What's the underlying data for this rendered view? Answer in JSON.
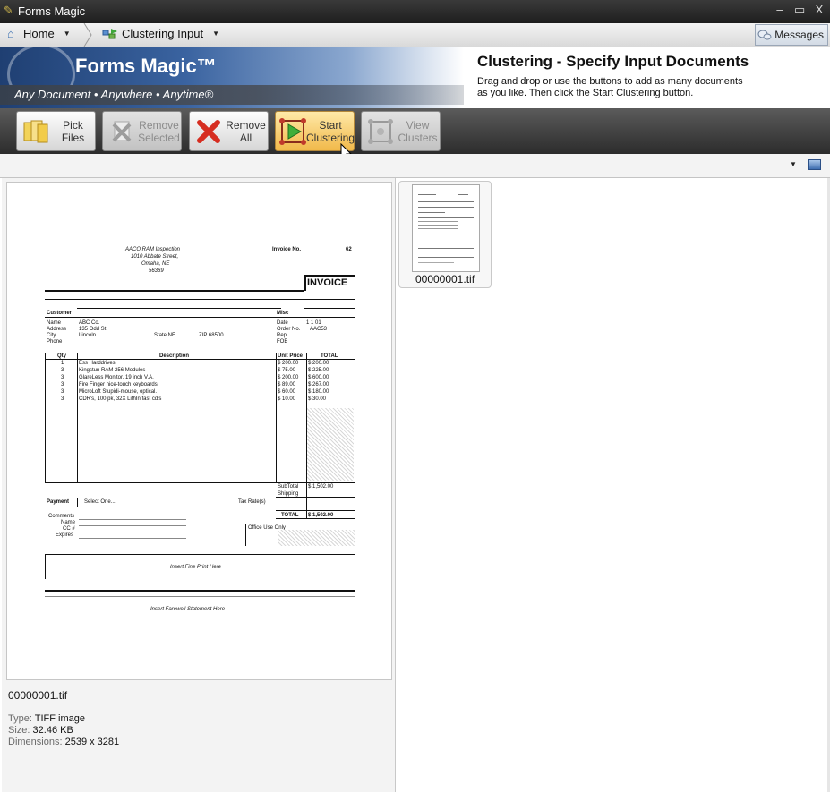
{
  "window": {
    "title": "Forms Magic",
    "controls": {
      "minimize": "‒",
      "maximize": "▭",
      "close": "X"
    }
  },
  "nav": {
    "home_label": "Home",
    "page_label": "Clustering Input",
    "messages_label": "Messages"
  },
  "banner": {
    "logo_title": "Forms Magic™",
    "tagline": "Any Document • Anywhere • Anytime®",
    "heading": "Clustering - Specify Input Documents",
    "instructions": "Drag and drop or use the buttons to add as many documents as you like. Then click the Start Clustering button."
  },
  "toolbar": {
    "pick_files": {
      "line1": "Pick",
      "line2": "Files",
      "enabled": true
    },
    "remove_selected": {
      "line1": "Remove",
      "line2": "Selected",
      "enabled": false
    },
    "remove_all": {
      "line1": "Remove",
      "line2": "All",
      "enabled": true
    },
    "start_clustering": {
      "line1": "Start",
      "line2": "Clustering",
      "enabled": true,
      "hovered": true
    },
    "view_clusters": {
      "line1": "View",
      "line2": "Clusters",
      "enabled": false
    }
  },
  "preview": {
    "filename": "00000001.tif",
    "type_label": "Type:",
    "type_value": "TIFF image",
    "size_label": "Size:",
    "size_value": "32.46 KB",
    "dimensions_label": "Dimensions:",
    "dimensions_value": "2539 x 3281"
  },
  "invoice": {
    "company": "AACO RAM Inspection",
    "street": "1010 Abbate Street,",
    "city": "Omaha, NE",
    "zip": "56369",
    "invoice_no_label": "Invoice No.",
    "invoice_no": "62",
    "title": "INVOICE",
    "customer_label": "Customer",
    "misc_label": "Misc",
    "name_label": "Name",
    "name_value": "ABC Co.",
    "address_label": "Address",
    "address_value": "135 Odd St",
    "city_label": "City",
    "city_value": "Lincoln",
    "state_label": "State NE",
    "zip_label": "ZIP 68500",
    "phone_label": "Phone",
    "date_label": "Date",
    "date_value": "1 1 01",
    "order_label": "Order No.",
    "order_value": "AAC53",
    "rep_label": "Rep",
    "fob_label": "FOB",
    "col_qty": "Qty",
    "col_desc": "Description",
    "col_price": "Unit Price",
    "col_total": "TOTAL",
    "items": [
      {
        "qty": "1",
        "desc": "Ess Harddrives",
        "price": "$ 200.00",
        "total": "$ 200.00"
      },
      {
        "qty": "3",
        "desc": "Kingstun RAM 256 Modules",
        "price": "$ 75.00",
        "total": "$ 225.00"
      },
      {
        "qty": "3",
        "desc": "GlareLess Monitor, 19 inch V.A.",
        "price": "$ 200.00",
        "total": "$ 600.00"
      },
      {
        "qty": "3",
        "desc": "Fire Finger nice-touch keyboards",
        "price": "$ 89.00",
        "total": "$ 267.00"
      },
      {
        "qty": "3",
        "desc": "MicroLoft Stupidi-mouse, optical.",
        "price": "$ 60.00",
        "total": "$ 180.00"
      },
      {
        "qty": "3",
        "desc": "CDR's, 100 pk, 32X LithIn fast cd's",
        "price": "$ 10.00",
        "total": "$ 30.00"
      }
    ],
    "subtotal_label": "SubTotal",
    "subtotal_value": "$ 1,502.00",
    "shipping_label": "Shipping",
    "payment_label": "Payment",
    "payment_value": "Select One...",
    "tax_label": "Tax Rate(s)",
    "total_label": "TOTAL",
    "total_value": "$ 1,502.00",
    "comments_label": "Comments",
    "pname_label": "Name",
    "cc_label": "CC #",
    "expires_label": "Expires",
    "office_label": "Office Use Only",
    "fine_print": "Insert Fine Print Here",
    "farewell": "Insert Farewell Statement Here"
  },
  "thumbnails": [
    {
      "filename": "00000001.tif"
    }
  ]
}
